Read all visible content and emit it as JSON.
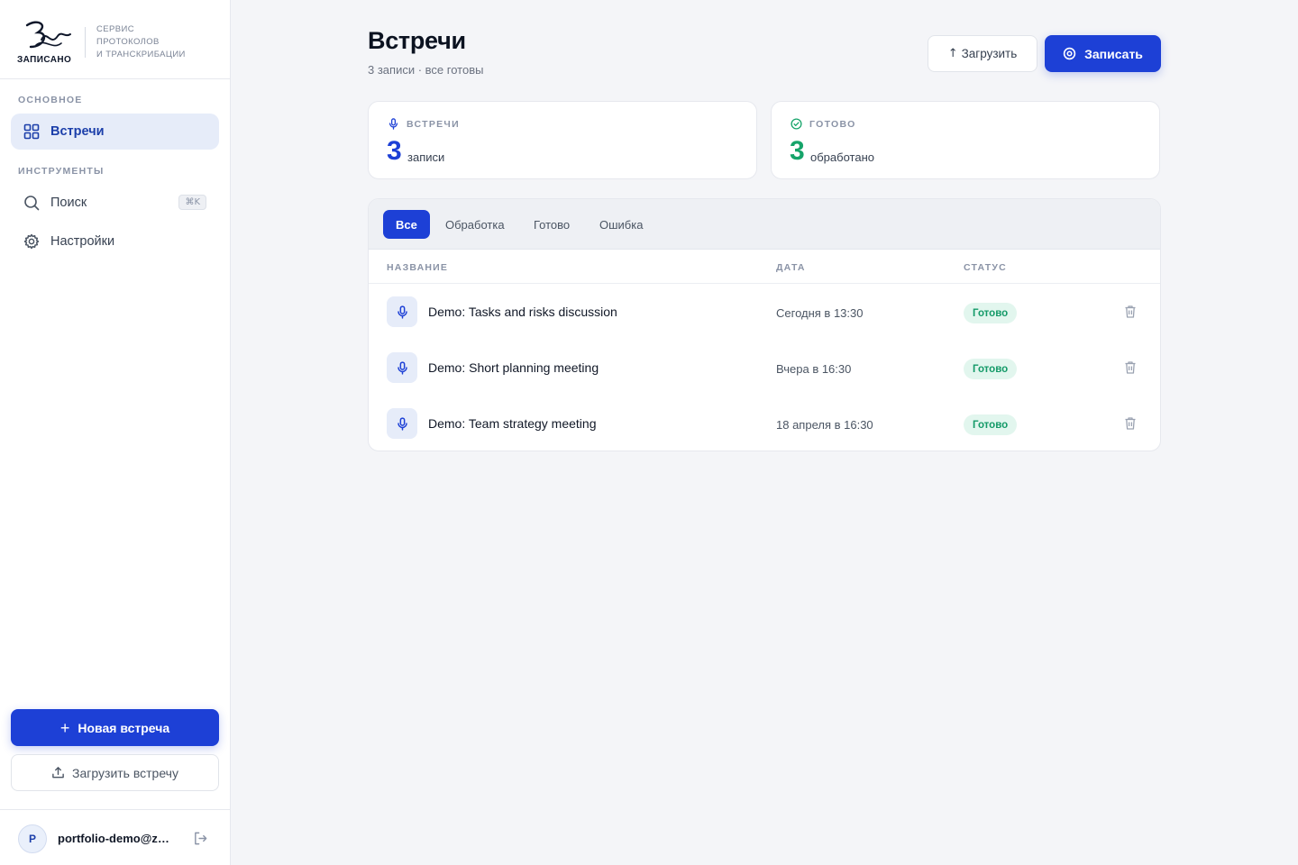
{
  "brand": {
    "logo_word": "ЗАПИСАНО",
    "tagline": [
      "СЕРВИС",
      "ПРОТОКОЛОВ",
      "И ТРАНСКРИБАЦИИ"
    ]
  },
  "sidebar": {
    "section_main": "ОСНОВНОЕ",
    "section_tools": "ИНСТРУМЕНТЫ",
    "items": [
      {
        "label": "Встречи",
        "icon": "grid-icon",
        "active": true
      },
      {
        "label": "Поиск",
        "icon": "search-icon",
        "shortcut": "⌘K"
      },
      {
        "label": "Настройки",
        "icon": "gear-icon"
      }
    ],
    "new_meeting_label": "Новая встреча",
    "new_meeting_plus": "+",
    "upload_meeting_label": "Загрузить встречу",
    "user": {
      "initial": "P",
      "email": "portfolio-demo@zapisano.app"
    }
  },
  "header": {
    "title": "Встречи",
    "subtitle": "3 записи · все готовы",
    "load_label": "Загрузить",
    "load_arrow": "↑",
    "record_label": "Записать"
  },
  "stats": [
    {
      "label": "ВСТРЕЧИ",
      "value": "3",
      "unit": "записи",
      "color": "#1d40d6",
      "icon": "mic-icon"
    },
    {
      "label": "ГОТОВО",
      "value": "3",
      "unit": "обработано",
      "color": "#16a46a",
      "icon": "check-circle-icon"
    }
  ],
  "tabs": [
    {
      "label": "Все",
      "active": true
    },
    {
      "label": "Обработка"
    },
    {
      "label": "Готово"
    },
    {
      "label": "Ошибка"
    }
  ],
  "table": {
    "columns": [
      "НАЗВАНИЕ",
      "ДАТА",
      "СТАТУС"
    ],
    "rows": [
      {
        "title": "Demo: Tasks and risks discussion",
        "date": "Сегодня в 13:30",
        "status": "Готово"
      },
      {
        "title": "Demo: Short planning meeting",
        "date": "Вчера в 16:30",
        "status": "Готово"
      },
      {
        "title": "Demo: Team strategy meeting",
        "date": "18 апреля в 16:30",
        "status": "Готово"
      }
    ]
  },
  "colors": {
    "accent": "#1d40d6",
    "success": "#16a46a",
    "background": "#f4f5f8"
  }
}
